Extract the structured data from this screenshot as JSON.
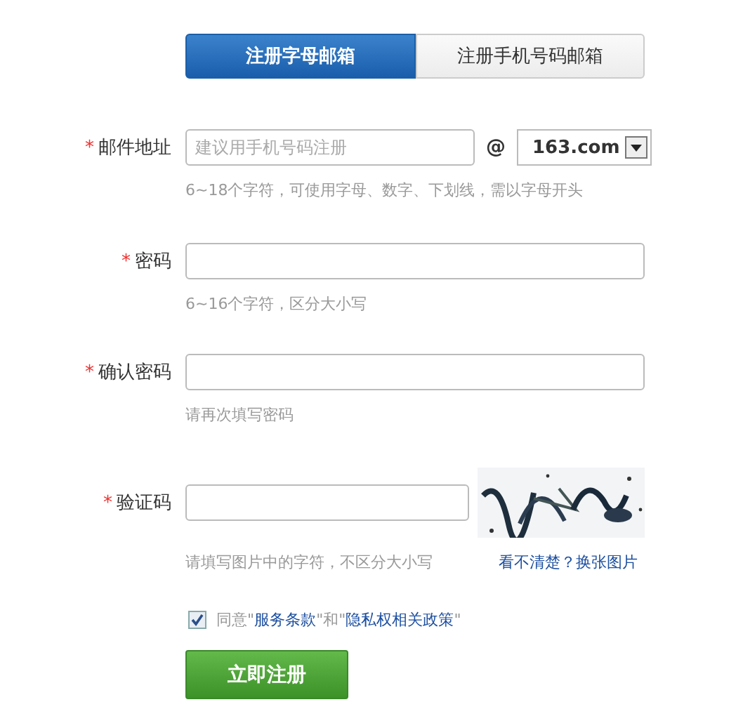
{
  "tabs": [
    {
      "label": "注册字母邮箱",
      "selected": true
    },
    {
      "label": "注册手机号码邮箱",
      "selected": false
    }
  ],
  "fields": [
    {
      "kind": "email",
      "label": "邮件地址",
      "required_mark": "*",
      "placeholder": "建议用手机号码注册",
      "at": "@",
      "domain": "163.com",
      "hint": "6~18个字符，可使用字母、数字、下划线，需以字母开头"
    },
    {
      "kind": "text",
      "label": "密码",
      "required_mark": "*",
      "hint": "6~16个字符，区分大小写"
    },
    {
      "kind": "text",
      "label": "确认密码",
      "required_mark": "*",
      "hint": "请再次填写密码"
    },
    {
      "kind": "captcha",
      "label": "验证码",
      "required_mark": "*",
      "hint": "请填写图片中的字符，不区分大小写",
      "refresh": "看不清楚？换张图片"
    }
  ],
  "agreement": {
    "checked": true,
    "prefix": "同意\"",
    "link_1": "服务条款",
    "middle": "\"和\"",
    "link_2": "隐私权相关政策",
    "suffix": "\""
  },
  "submit": "立即注册"
}
